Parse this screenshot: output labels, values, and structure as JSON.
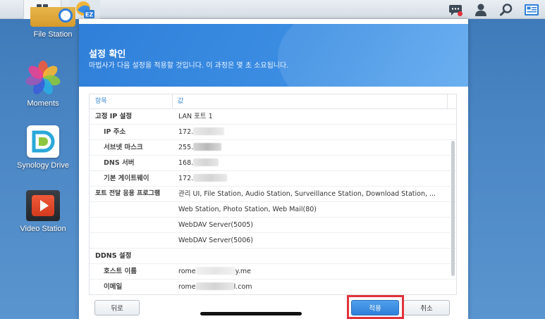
{
  "taskbar": {
    "main_menu_icon": "grid-icon",
    "active_app_badge": "EZ",
    "right_icons": [
      "chat-icon",
      "user-icon",
      "search-icon",
      "widgets-icon"
    ]
  },
  "desktop": {
    "icons": [
      {
        "label": "File Station",
        "icon": "file-station-icon"
      },
      {
        "label": "Moments",
        "icon": "moments-icon"
      },
      {
        "label": "Synology Drive",
        "icon": "synology-drive-icon"
      },
      {
        "label": "Video Station",
        "icon": "video-station-icon"
      }
    ]
  },
  "wizard": {
    "title": "설정 확인",
    "subtitle": "마법사가 다음 설정을 적용할 것입니다. 이 과정은 몇 초 소요됩니다.",
    "table": {
      "header_item": "항목",
      "header_value": "값",
      "rows": [
        {
          "key": "고정 IP 설정",
          "value": "LAN 포트 1"
        },
        {
          "key": "IP 주소",
          "value": "172."
        },
        {
          "key": "서브넷 마스크",
          "value": "255."
        },
        {
          "key": "DNS 서버",
          "value": "168."
        },
        {
          "key": "기본 게이트웨이",
          "value": "172."
        },
        {
          "key": "포트 전달 응용 프로그램",
          "value": "관리 UI, File Station, Audio Station, Surveillance Station, Download Station, ..."
        },
        {
          "key": "",
          "value": "Web Station, Photo Station, Web Mail(80)"
        },
        {
          "key": "",
          "value": "WebDAV Server(5005)"
        },
        {
          "key": "",
          "value": "WebDAV Server(5006)"
        },
        {
          "key": "DDNS 설정",
          "value": ""
        },
        {
          "key": "호스트 이름",
          "value_prefix": "rome",
          "value_suffix": "y.me"
        },
        {
          "key": "이메일",
          "value_prefix": "rome",
          "value_suffix": "l.com"
        }
      ]
    },
    "buttons": {
      "back": "뒤로",
      "apply": "적용",
      "cancel": "취소"
    }
  },
  "colors": {
    "accent": "#2f7fd9",
    "highlight": "#e2323c",
    "header_text": "#3a8ad8"
  }
}
